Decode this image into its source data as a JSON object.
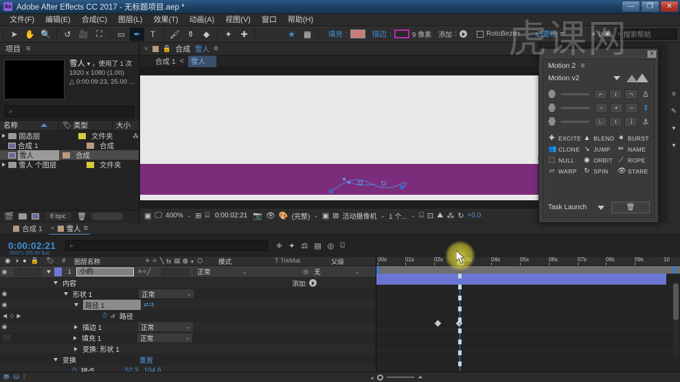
{
  "window": {
    "title": "Adobe After Effects CC 2017 - 无标题项目.aep *",
    "logo": "Ae",
    "minimize": "—",
    "maximize": "❐",
    "close": "✕"
  },
  "menubar": [
    "文件(F)",
    "编辑(E)",
    "合成(C)",
    "图层(L)",
    "效果(T)",
    "动画(A)",
    "视图(V)",
    "窗口",
    "帮助(H)"
  ],
  "toolbar": {
    "tools": [
      {
        "name": "selection-tool",
        "glyph": "➤"
      },
      {
        "name": "hand-tool",
        "glyph": "✋"
      },
      {
        "name": "zoom-tool",
        "glyph": "🔍"
      },
      {
        "name": "rotation-tool",
        "glyph": "↺"
      },
      {
        "name": "camera-tool",
        "glyph": "🎥"
      },
      {
        "name": "anchor-point-tool",
        "glyph": "⛶"
      },
      {
        "name": "shape-tool",
        "glyph": "▭"
      },
      {
        "name": "pen-tool",
        "glyph": "✒"
      },
      {
        "name": "text-tool",
        "glyph": "T"
      },
      {
        "name": "brush-tool",
        "glyph": "🖌"
      },
      {
        "name": "clone-stamp-tool",
        "glyph": "⚱"
      },
      {
        "name": "eraser-tool",
        "glyph": "◆"
      },
      {
        "name": "roto-brush-tool",
        "glyph": "✦"
      },
      {
        "name": "puppet-pin-tool",
        "glyph": "✚"
      }
    ],
    "star_icon": "★",
    "grid_icon": "▦",
    "fill_label": "填充",
    "fill_color": "#c77e78",
    "stroke_label": "描边",
    "stroke_color": "#b92bb9",
    "stroke_width": "9 像素",
    "add_label": "添加",
    "rotobezier_label": "RotoBezier",
    "workspace_label": "必要项",
    "search_placeholder": "搜索帮助"
  },
  "project_panel": {
    "tab_title": "项目",
    "item_name": "雪人",
    "item_usage": "，使用了 1 次",
    "dimensions": "1920 x 1080 (1.00)",
    "duration": "0:00:09:23, 25.00 ...",
    "search_placeholder": "",
    "columns": [
      "名称",
      "类型",
      "大小"
    ],
    "rows": [
      {
        "name": "固态层",
        "type": "文件夹",
        "icon": "folder-icon",
        "tag": "yellow",
        "expandable": true,
        "selected": false
      },
      {
        "name": "合成 1",
        "type": "合成",
        "icon": "comp-icon",
        "tag": "tan",
        "expandable": false,
        "selected": false
      },
      {
        "name": "雪人",
        "type": "合成",
        "icon": "comp-icon",
        "tag": "tan",
        "expandable": false,
        "selected": true
      },
      {
        "name": "雪人 个图层",
        "type": "文件夹",
        "icon": "folder-icon",
        "tag": "yellow",
        "expandable": true,
        "selected": false
      }
    ],
    "bit_depth": "8 bpc"
  },
  "comp_panel": {
    "tab_label": "合成",
    "tab_name": "雪人",
    "breadcrumb_root": "合成 1",
    "breadcrumb_sep": "<",
    "breadcrumb_current": "雪人",
    "footer": {
      "zoom": "400%",
      "timecode": "0:00:02:21",
      "resolution": "(完整)",
      "camera": "活动摄像机",
      "views": "1 个...",
      "exposure": "+0.0"
    }
  },
  "motion_panel": {
    "title": "Motion 2",
    "version_label": "Motion v2",
    "close": "✕",
    "pads": [
      "⌐",
      "ı",
      "¬",
      "–",
      "▪",
      "–",
      "∟",
      "ı",
      "˩"
    ],
    "anchors": [
      "♙",
      "⇕",
      "⚓"
    ],
    "tools": [
      {
        "label": "EXCITE",
        "icon": "✚"
      },
      {
        "label": "BLEND",
        "icon": "▲"
      },
      {
        "label": "BURST",
        "icon": "✷"
      },
      {
        "label": "CLONE",
        "icon": "👥"
      },
      {
        "label": "JUMP",
        "icon": "↘"
      },
      {
        "label": "NAME",
        "icon": "✏"
      },
      {
        "label": "NULL",
        "icon": "⬚"
      },
      {
        "label": "ORBIT",
        "icon": "◉"
      },
      {
        "label": "ROPE",
        "icon": "⟋"
      },
      {
        "label": "WARP",
        "icon": "▱"
      },
      {
        "label": "SPIN",
        "icon": "↻"
      },
      {
        "label": "STARE",
        "icon": "👁"
      }
    ],
    "task_launch_label": "Task Launch",
    "trash_icon": "🗑"
  },
  "timeline": {
    "tabs": [
      {
        "label": "合成 1",
        "active": false
      },
      {
        "label": "雪人",
        "active": true
      }
    ],
    "current_time": "0:00:02:21",
    "frame_info": "00071 (25.00 fps)",
    "search_placeholder": "",
    "columns": {
      "name": "图层名称",
      "mode": "模式",
      "t": "T",
      "trkmat": "TrkMat",
      "parent": "父级"
    },
    "layer": {
      "index": "1",
      "name": "小的",
      "mode": "正常",
      "parent": "无"
    },
    "rows": [
      {
        "label": "内容",
        "indent": 1,
        "arrow": "down",
        "extra": "添加:",
        "type": "group"
      },
      {
        "label": "形状 1",
        "indent": 2,
        "arrow": "down",
        "mode": "正常",
        "eye": true,
        "type": "shape"
      },
      {
        "label": "路径 1",
        "indent": 3,
        "arrow": "down",
        "eye": true,
        "highlight": true,
        "type": "path-group"
      },
      {
        "label": "路径",
        "indent": 5,
        "arrow": "none",
        "stopwatch": true,
        "type": "property",
        "keyframed": true
      },
      {
        "label": "描边 1",
        "indent": 3,
        "arrow": "right",
        "mode": "正常",
        "eye": true,
        "type": "stroke"
      },
      {
        "label": "填充 1",
        "indent": 3,
        "arrow": "right",
        "mode": "正常",
        "eye": false,
        "type": "fill"
      },
      {
        "label": "变换: 形状 1",
        "indent": 3,
        "arrow": "right",
        "type": "transform-group"
      },
      {
        "label": "变换",
        "indent": 2,
        "arrow": "down",
        "reset": "重置",
        "type": "transform"
      },
      {
        "label": "锚点",
        "indent": 3,
        "arrow": "none",
        "value": "52.3 , 104.6",
        "stopwatch": true,
        "type": "property"
      }
    ],
    "ruler_ticks": [
      "00s",
      "01s",
      "02s",
      "03s",
      "04s",
      "05s",
      "06s",
      "07s",
      "08s",
      "09s",
      "10"
    ],
    "keyframes": [
      2.05,
      2.85
    ],
    "playhead_seconds": 2.85
  },
  "watermark": "虎课网"
}
